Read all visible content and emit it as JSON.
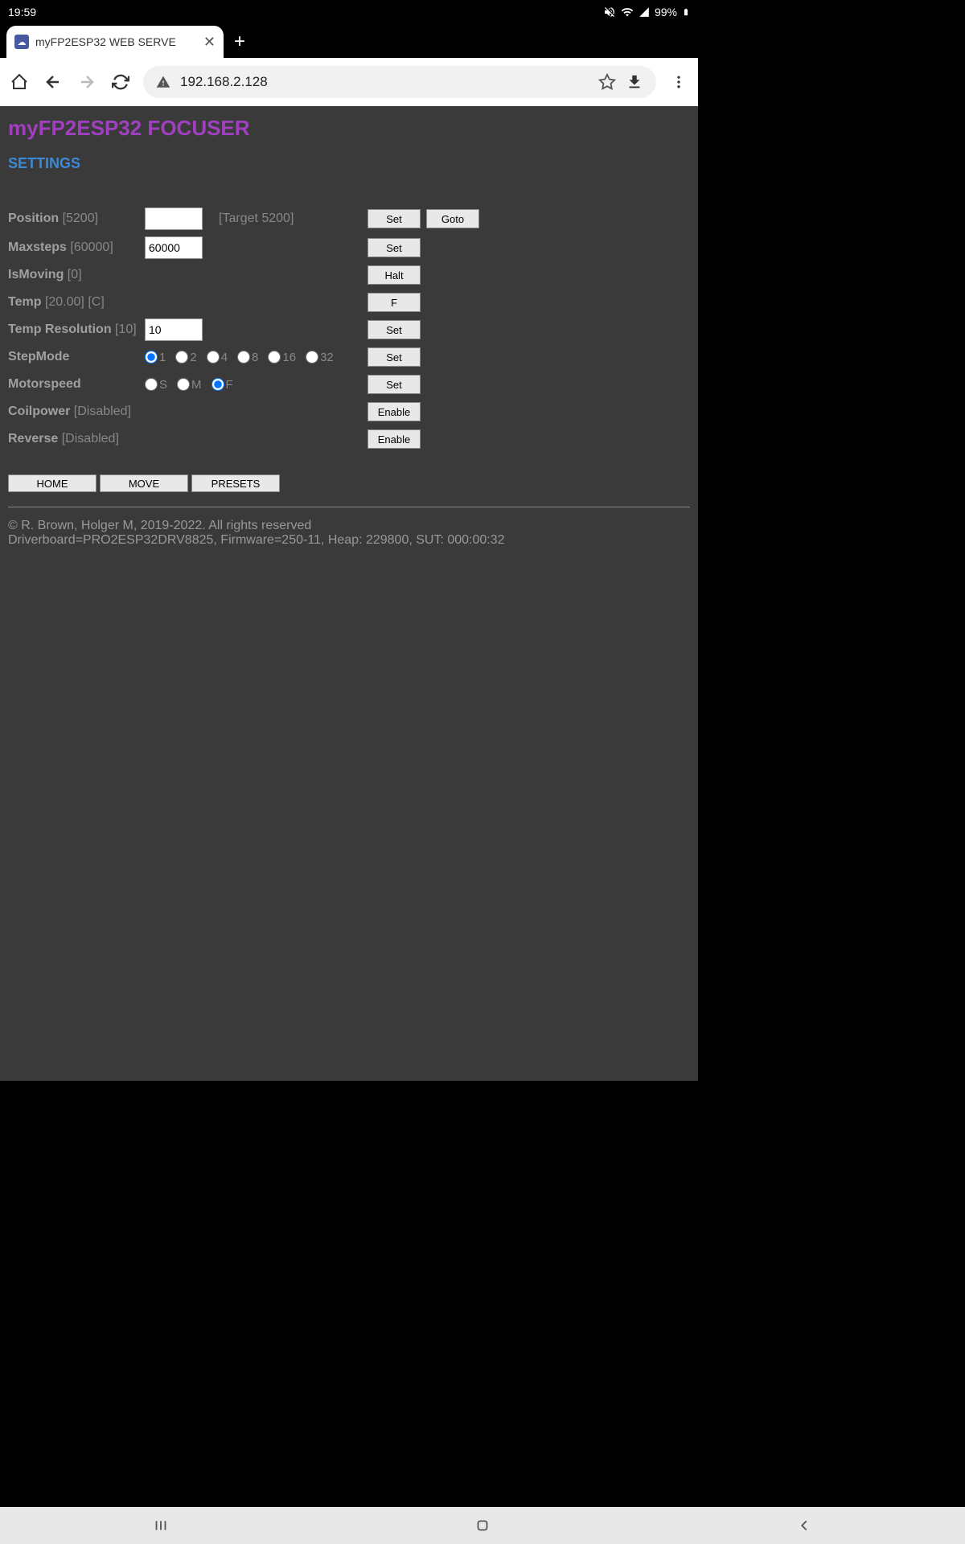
{
  "status_bar": {
    "time": "19:59",
    "battery": "99%"
  },
  "tab": {
    "title": "myFP2ESP32 WEB SERVE"
  },
  "url": {
    "address": "192.168.2.128"
  },
  "page": {
    "title": "myFP2ESP32 FOCUSER",
    "subtitle": "SETTINGS",
    "position": {
      "label": "Position",
      "value": "[5200]",
      "input": "",
      "target": "[Target 5200]",
      "set_btn": "Set",
      "goto_btn": "Goto"
    },
    "maxsteps": {
      "label": "Maxsteps",
      "value": "[60000]",
      "input": "60000",
      "set_btn": "Set"
    },
    "ismoving": {
      "label": "IsMoving",
      "value": "[0]",
      "halt_btn": "Halt"
    },
    "temp": {
      "label": "Temp",
      "value": "[20.00] [C]",
      "f_btn": "F"
    },
    "tempres": {
      "label": "Temp Resolution",
      "value": "[10]",
      "input": "10",
      "set_btn": "Set"
    },
    "stepmode": {
      "label": "StepMode",
      "options": [
        "1",
        "2",
        "4",
        "8",
        "16",
        "32"
      ],
      "selected": "1",
      "set_btn": "Set"
    },
    "motorspeed": {
      "label": "Motorspeed",
      "options": [
        "S",
        "M",
        "F"
      ],
      "selected": "F",
      "set_btn": "Set"
    },
    "coilpower": {
      "label": "Coilpower",
      "value": "[Disabled]",
      "enable_btn": "Enable"
    },
    "reverse": {
      "label": "Reverse",
      "value": "[Disabled]",
      "enable_btn": "Enable"
    },
    "footer_buttons": {
      "home": "HOME",
      "move": "MOVE",
      "presets": "PRESETS"
    },
    "copyright": "© R. Brown, Holger M, 2019-2022. All rights reserved",
    "firmware": "Driverboard=PRO2ESP32DRV8825, Firmware=250-11, Heap: 229800, SUT: 000:00:32"
  }
}
